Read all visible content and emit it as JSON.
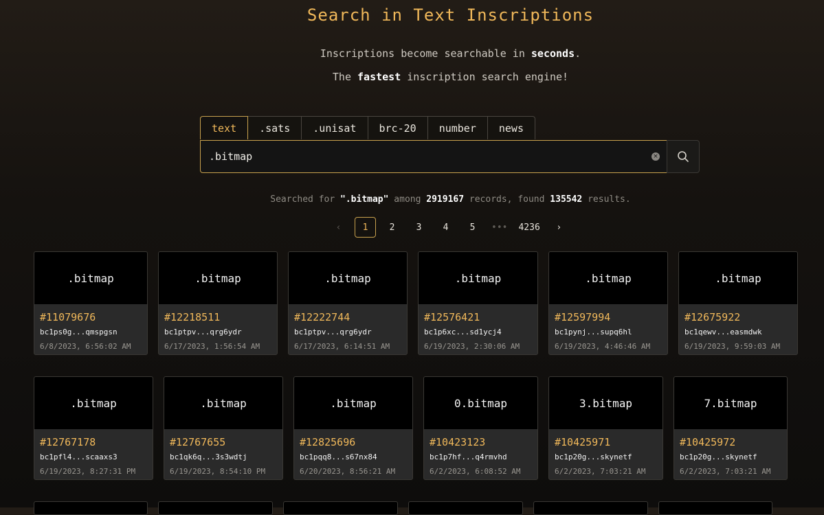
{
  "header": {
    "title": "Search in Text Inscriptions",
    "sub1_a": "Inscriptions become searchable in ",
    "sub1_b": "seconds",
    "sub1_c": ".",
    "sub2_a": "The ",
    "sub2_b": "fastest",
    "sub2_c": " inscription search engine!"
  },
  "tabs": [
    ".sats",
    ".unisat",
    "brc-20",
    "number",
    "news"
  ],
  "active_tab": "text",
  "search": {
    "value": ".bitmap",
    "clear_icon": "×",
    "icon": "search-icon"
  },
  "summary": {
    "a": "Searched for ",
    "query": "\".bitmap\"",
    "b": " among ",
    "records": "2919167",
    "c": " records, found ",
    "results": "135542",
    "d": " results."
  },
  "pagination": {
    "prev": "‹",
    "pages": [
      "1",
      "2",
      "3",
      "4",
      "5"
    ],
    "ellipsis": "•••",
    "last": "4236",
    "next": "›",
    "current": "1"
  },
  "cards": [
    {
      "text": ".bitmap",
      "number": "#11079676",
      "address": "bc1ps0g...qmspgsn",
      "time": "6/8/2023, 6:56:02 AM"
    },
    {
      "text": ".bitmap",
      "number": "#12218511",
      "address": "bc1ptpv...qrg6ydr",
      "time": "6/17/2023, 1:56:54 AM"
    },
    {
      "text": ".bitmap",
      "number": "#12222744",
      "address": "bc1ptpv...qrg6ydr",
      "time": "6/17/2023, 6:14:51 AM"
    },
    {
      "text": ".bitmap",
      "number": "#12576421",
      "address": "bc1p6xc...sd1ycj4",
      "time": "6/19/2023, 2:30:06 AM"
    },
    {
      "text": ".bitmap",
      "number": "#12597994",
      "address": "bc1pynj...supq6hl",
      "time": "6/19/2023, 4:46:46 AM"
    },
    {
      "text": ".bitmap",
      "number": "#12675922",
      "address": "bc1qewv...easmdwk",
      "time": "6/19/2023, 9:59:03 AM"
    },
    {
      "text": ".bitmap",
      "number": "#12767178",
      "address": "bc1pfl4...scaaxs3",
      "time": "6/19/2023, 8:27:31 PM"
    },
    {
      "text": ".bitmap",
      "number": "#12767655",
      "address": "bc1qk6q...3s3wdtj",
      "time": "6/19/2023, 8:54:10 PM"
    },
    {
      "text": ".bitmap",
      "number": "#12825696",
      "address": "bc1pqq8...s67nx84",
      "time": "6/20/2023, 8:56:21 AM"
    },
    {
      "text": "0.bitmap",
      "number": "#10423123",
      "address": "bc1p7hf...q4rmvhd",
      "time": "6/2/2023, 6:08:52 AM"
    },
    {
      "text": "3.bitmap",
      "number": "#10425971",
      "address": "bc1p20g...skynetf",
      "time": "6/2/2023, 7:03:21 AM"
    },
    {
      "text": "7.bitmap",
      "number": "#10425972",
      "address": "bc1p20g...skynetf",
      "time": "6/2/2023, 7:03:21 AM"
    }
  ],
  "colors": {
    "accent": "#f0b85a",
    "border_accent": "#c9a24e",
    "card_bg": "#2a2a2a"
  }
}
